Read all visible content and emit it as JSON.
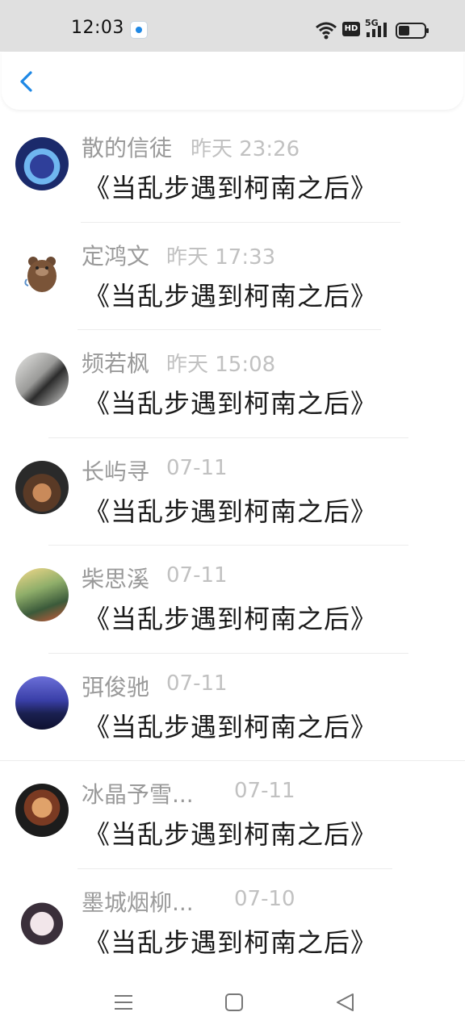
{
  "status_bar": {
    "time": "12:03",
    "hd_label": "HD",
    "network_label": "5G",
    "icons": [
      "notification-app-icon",
      "wifi-icon",
      "hd-icon",
      "signal-5g-icon",
      "battery-icon"
    ]
  },
  "header": {
    "back_icon": "chevron-left-icon",
    "accent_color": "#1e88e5"
  },
  "comments": [
    {
      "name": "散的信徒",
      "time": "昨天 23:26",
      "text": "《当乱步遇到柯南之后》"
    },
    {
      "name": "定鸿文",
      "time": "昨天 17:33",
      "text": "《当乱步遇到柯南之后》"
    },
    {
      "name": "频若枫",
      "time": "昨天 15:08",
      "text": "《当乱步遇到柯南之后》"
    },
    {
      "name": "长屿寻",
      "time": "07-11",
      "text": "《当乱步遇到柯南之后》"
    },
    {
      "name": "柴思溪",
      "time": "07-11",
      "text": "《当乱步遇到柯南之后》"
    },
    {
      "name": "弭俊驰",
      "time": "07-11",
      "text": "《当乱步遇到柯南之后》"
    },
    {
      "name": "冰晶予雪...",
      "time": "07-11",
      "text": "《当乱步遇到柯南之后》"
    },
    {
      "name": "墨城烟柳...",
      "time": "07-10",
      "text": "《当乱步遇到柯南之后》"
    }
  ],
  "nav_bar": {
    "icons": [
      "menu-icon",
      "home-icon",
      "back-triangle-icon"
    ]
  }
}
